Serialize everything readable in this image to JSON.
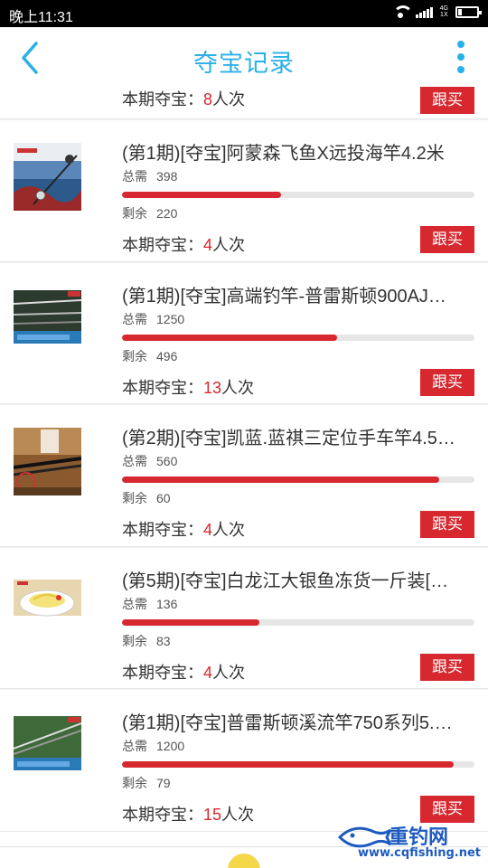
{
  "status_bar": {
    "time": "晚上11:31",
    "network_top": "4G",
    "network_bottom": "1X"
  },
  "header": {
    "title": "夺宝记录"
  },
  "labels": {
    "total": "总需",
    "remain": "剩余",
    "per_prefix": "本期夺宝：",
    "per_suffix": "人次",
    "follow": "跟买"
  },
  "partial_item": {
    "count": "8"
  },
  "items": [
    {
      "name": "(第1期)[夺宝]阿蒙森飞鱼X远投海竿4.2米",
      "total": "398",
      "remain": "220",
      "count": "4",
      "progress": 0.45
    },
    {
      "name": "(第1期)[夺宝]高端钓竿-普雷斯顿900AJ…",
      "total": "1250",
      "remain": "496",
      "count": "13",
      "progress": 0.61
    },
    {
      "name": "(第2期)[夺宝]凯蓝.蓝祺三定位手车竿4.5…",
      "total": "560",
      "remain": "60",
      "count": "4",
      "progress": 0.9
    },
    {
      "name": "(第5期)[夺宝]白龙江大银鱼冻货一斤装[…",
      "total": "136",
      "remain": "83",
      "count": "4",
      "progress": 0.39
    },
    {
      "name": "(第1期)[夺宝]普雷斯顿溪流竿750系列5.…",
      "total": "1200",
      "remain": "79",
      "count": "15",
      "progress": 0.94
    }
  ],
  "watermark": {
    "brand": "重钓网",
    "site": "www.cqfishing.net"
  },
  "colors": {
    "accent": "#2ab0e8",
    "red": "#d7282f"
  }
}
